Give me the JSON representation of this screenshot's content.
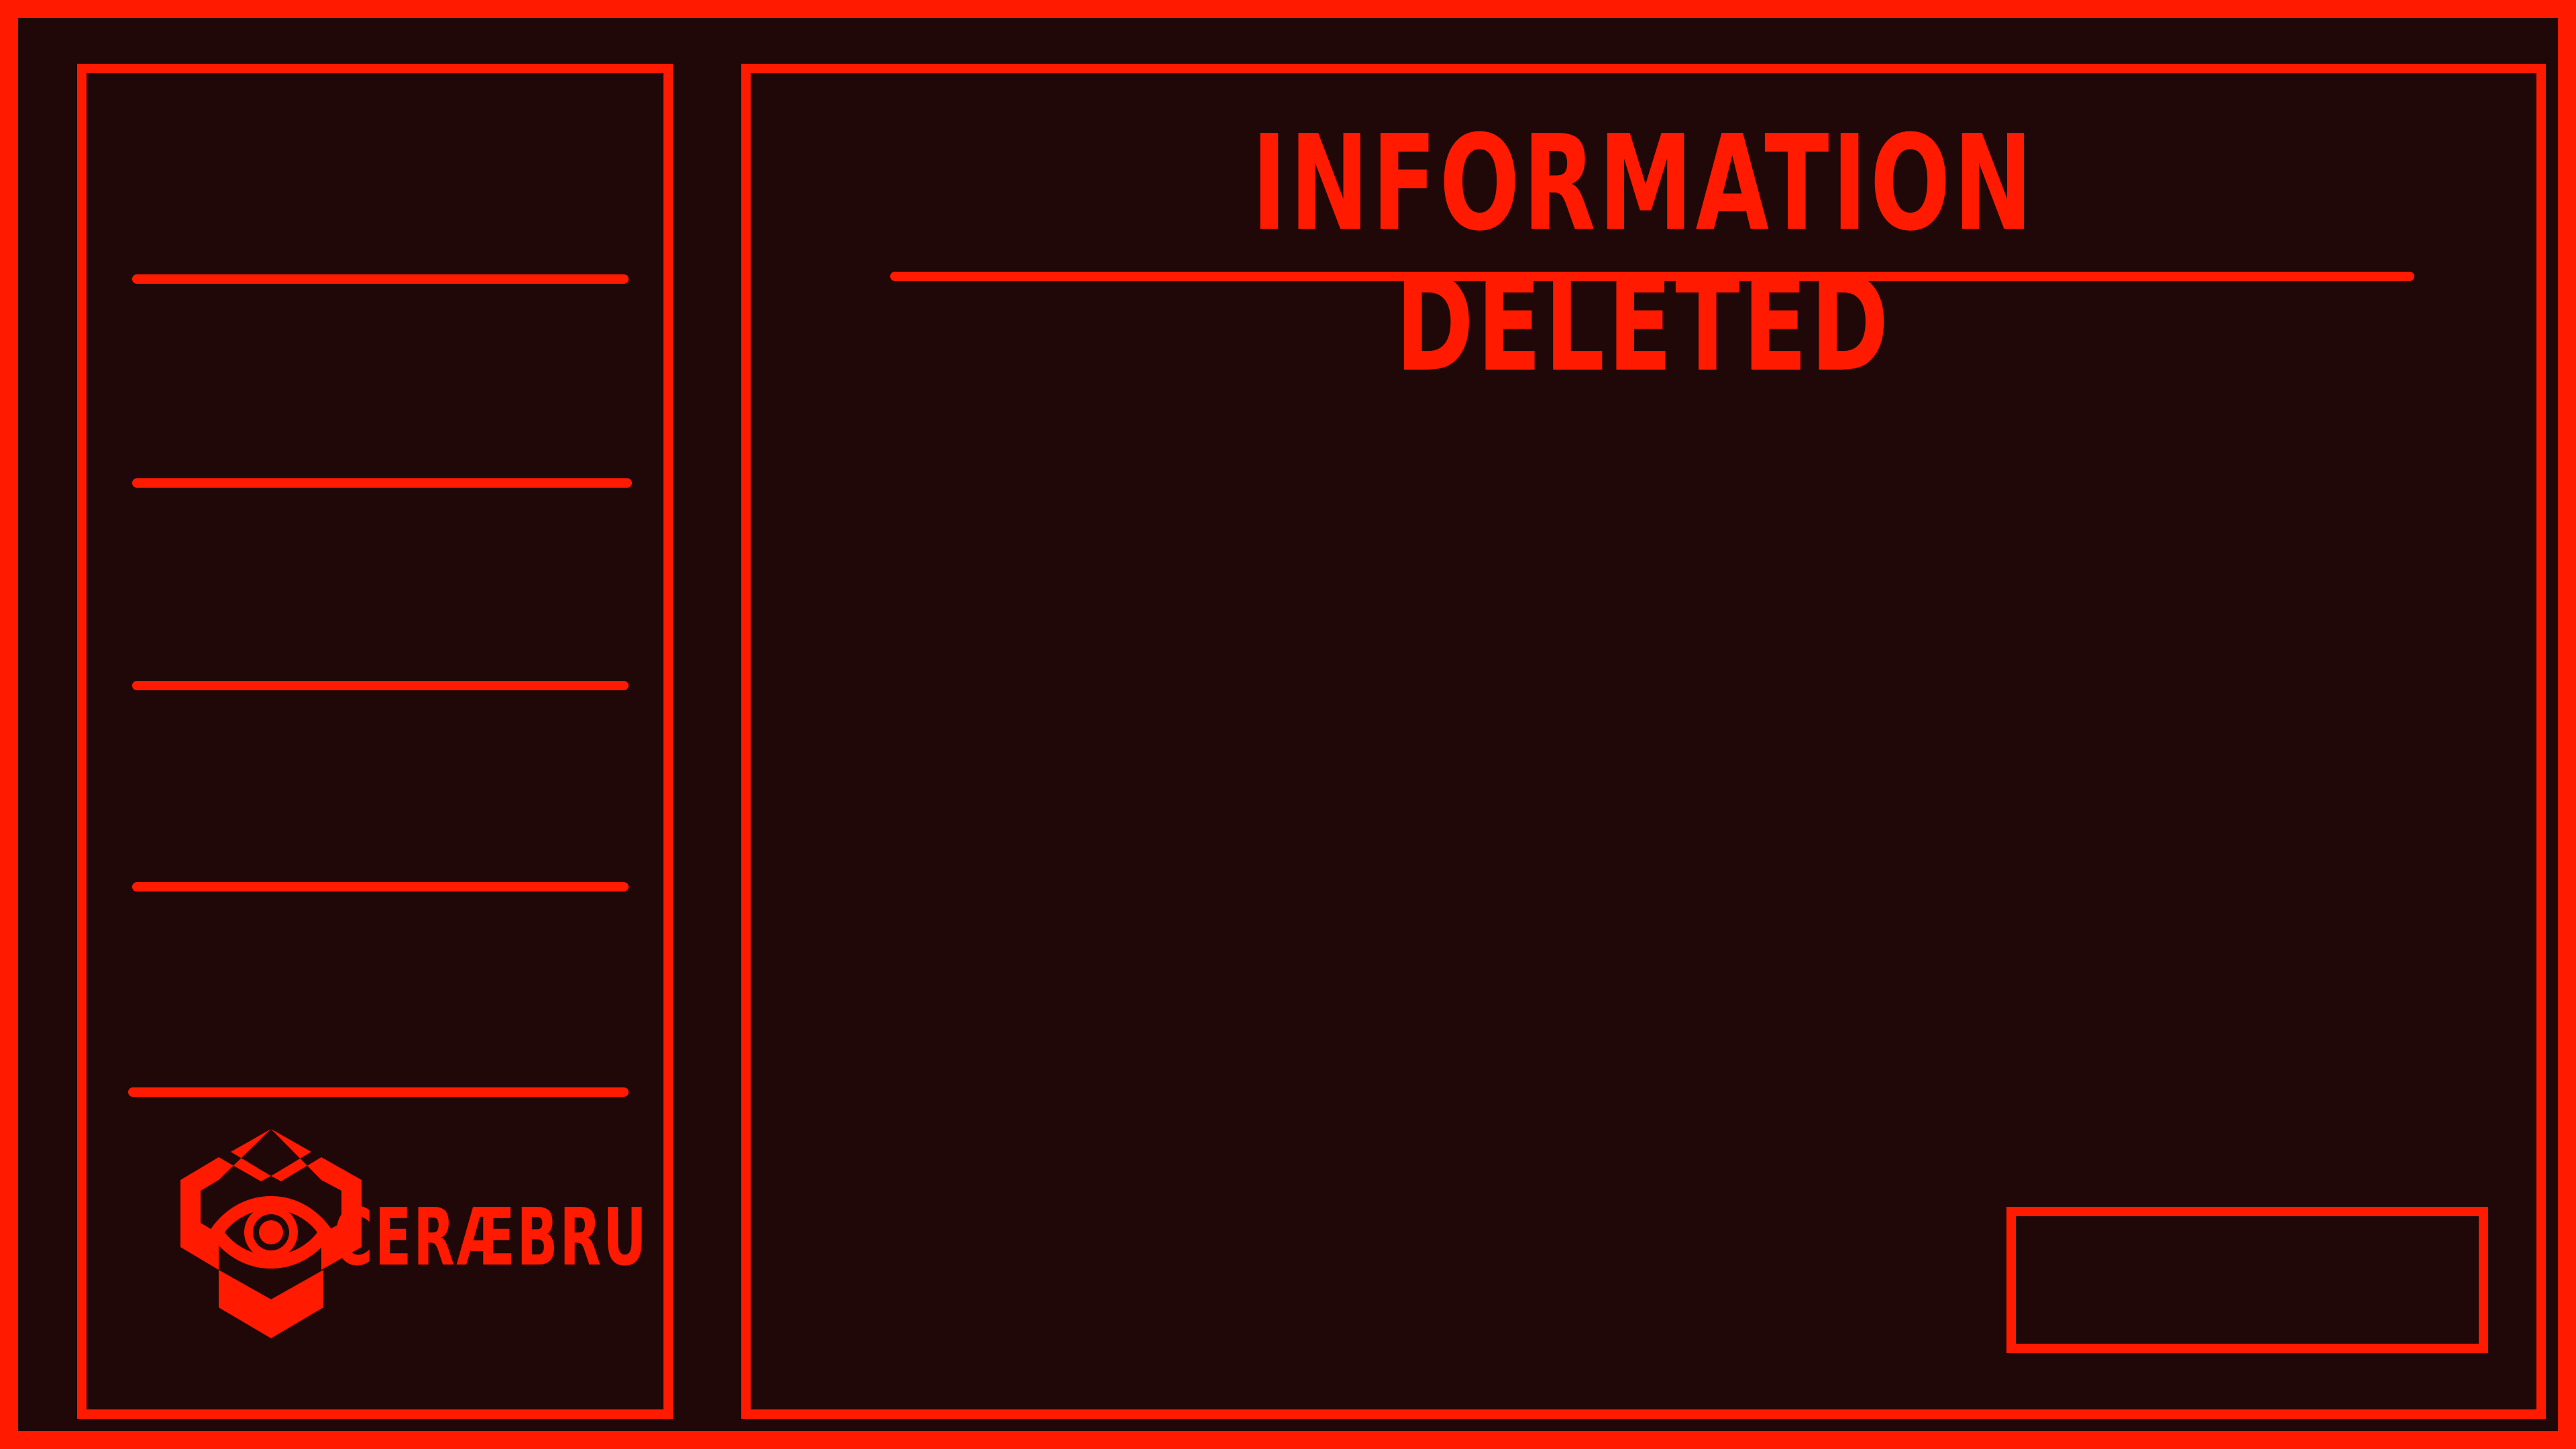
{
  "header": {
    "title": "INFORMATION DELETED"
  },
  "brand": {
    "name": "CERÆBRU",
    "logo_icon": "hexagon-eye-icon"
  },
  "sidebar": {
    "lines": [
      "",
      "",
      "",
      "",
      ""
    ]
  },
  "colors": {
    "accent": "#ff1a00",
    "background": "#200808"
  }
}
